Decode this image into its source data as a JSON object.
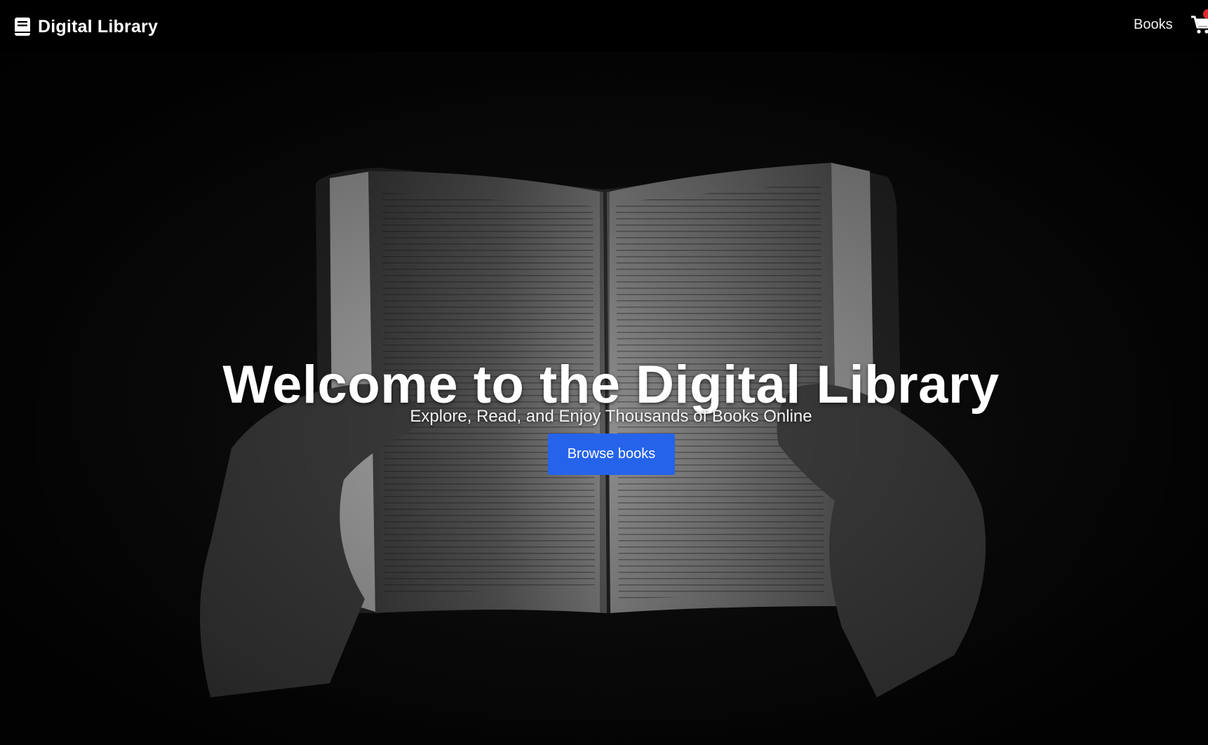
{
  "navbar": {
    "brand": "Digital Library",
    "brand_icon": "book-icon",
    "links": [
      "Books"
    ],
    "cart_icon": "shopping-cart-icon",
    "cart_badge_color": "#e0282e"
  },
  "hero": {
    "background": "open-book-held-in-hands-photo",
    "title": "Welcome to the Digital Library",
    "subtitle": "Explore, Read, and Enjoy Thousands of Books Online",
    "cta": "Browse books",
    "cta_color": "#2563eb"
  }
}
